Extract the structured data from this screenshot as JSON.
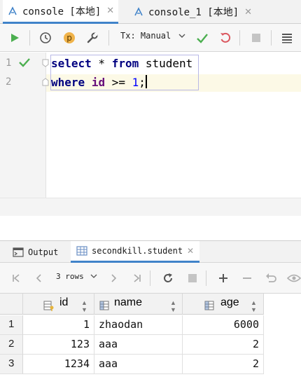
{
  "tabs": [
    {
      "label": "console [本地]",
      "active": true,
      "icon": "database-console-icon"
    },
    {
      "label": "console_1 [本地]",
      "active": false,
      "icon": "database-console-icon"
    }
  ],
  "toolbar": {
    "tx_label": "Tx: Manual",
    "buttons": [
      "run-icon",
      "history-icon",
      "profile-p-icon",
      "settings-wrench-icon",
      "commit-check-icon",
      "rollback-icon",
      "stop-icon",
      "layout-icon"
    ]
  },
  "editor": {
    "line_numbers": [
      "1",
      "2"
    ],
    "line1": {
      "kw1": "select",
      "rest1": " * ",
      "kw2": "from",
      "rest2": " student"
    },
    "line2": {
      "kw1": "where",
      "sp": " ",
      "ident": "id",
      "op": " >= ",
      "num": "1",
      "end": ";"
    }
  },
  "panel": {
    "tabs": [
      {
        "label": "Output",
        "active": false
      },
      {
        "label": "secondkill.student",
        "active": true
      }
    ],
    "rows_label": "3 rows"
  },
  "grid": {
    "columns": [
      "id",
      "name",
      "age"
    ],
    "row_numbers": [
      "1",
      "2",
      "3"
    ],
    "rows": [
      {
        "id": "1",
        "name": "zhaodan",
        "age": "6000"
      },
      {
        "id": "123",
        "name": "aaa",
        "age": "2"
      },
      {
        "id": "1234",
        "name": "aaa",
        "age": "2"
      }
    ]
  },
  "colors": {
    "keyword": "#000080",
    "identifier": "#660e7a",
    "number": "#0000ff",
    "run_green": "#4caf50",
    "rollback_red": "#db5860",
    "tab_underline": "#4083c9"
  }
}
